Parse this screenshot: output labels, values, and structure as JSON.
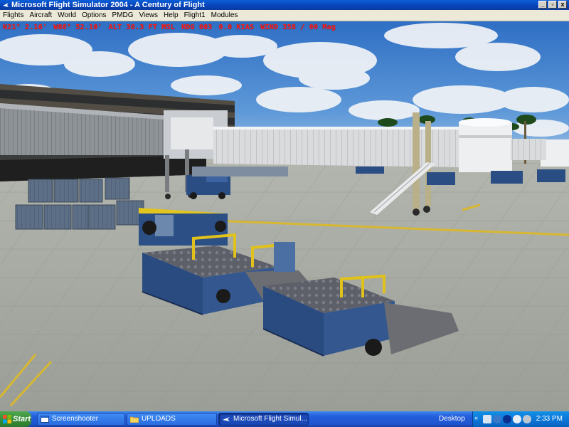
{
  "window": {
    "title": "Microsoft Flight Simulator 2004 - A Century of Flight",
    "controls": [
      "_",
      "▫",
      "x"
    ]
  },
  "menu": [
    "Flights",
    "Aircraft",
    "World",
    "Options",
    "PMDG",
    "Views",
    "Help",
    "Flight1",
    "Modules"
  ],
  "hud": {
    "lat": "N21° 2.16'",
    "lon": "W86° 52.10'",
    "alt": "ALT 36.3 FT MSL",
    "hdg": "HDG 003",
    "speed": "0.0 KIAS",
    "wind": "WIND 358 / 00 Mag"
  },
  "taskbar": {
    "start_label": "Start",
    "tasks": [
      {
        "label": "Screenshooter",
        "icon": "window-icon"
      },
      {
        "label": "UPLOADS",
        "icon": "folder-icon"
      },
      {
        "label": "Microsoft Flight Simul...",
        "icon": "airplane-icon"
      }
    ],
    "desktop_label": "Desktop",
    "clock": "2:33 PM"
  },
  "colors": {
    "hud_text": "#ff2020",
    "sky": "#4a88d0",
    "apron": "#a7aba4",
    "cart_blue": "#2c4f86",
    "rail_yellow": "#e0c21a"
  }
}
